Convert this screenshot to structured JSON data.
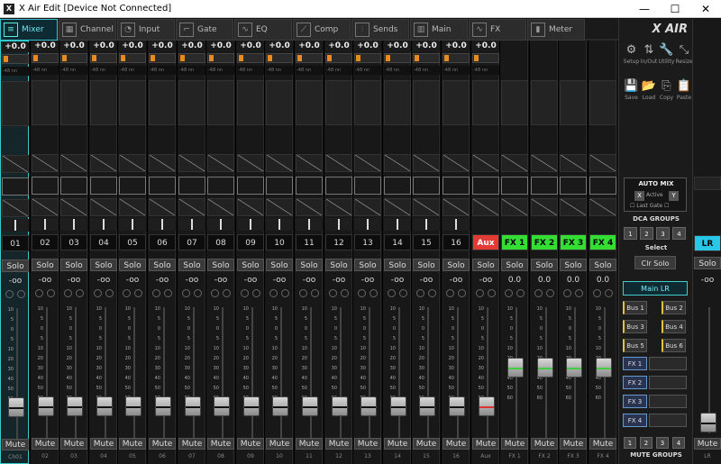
{
  "window": {
    "title": "X Air Edit [Device Not Connected]",
    "icon": "X",
    "min": "—",
    "max": "☐",
    "close": "✕"
  },
  "tabs": [
    {
      "label": "Mixer",
      "icon": "mixer-icon",
      "glyph": "≡"
    },
    {
      "label": "Channel",
      "icon": "channel-icon",
      "glyph": "▦"
    },
    {
      "label": "Input",
      "icon": "input-icon",
      "glyph": "◔"
    },
    {
      "label": "Gate",
      "icon": "gate-icon",
      "glyph": "⌐"
    },
    {
      "label": "EQ",
      "icon": "eq-icon",
      "glyph": "∿"
    },
    {
      "label": "Comp",
      "icon": "comp-icon",
      "glyph": "⟋"
    },
    {
      "label": "Sends",
      "icon": "sends-icon",
      "glyph": "⫶"
    },
    {
      "label": "Main",
      "icon": "main-icon",
      "glyph": "▥"
    },
    {
      "label": "FX",
      "icon": "fx-icon",
      "glyph": "∿"
    },
    {
      "label": "Meter",
      "icon": "meter-icon",
      "glyph": "▮"
    }
  ],
  "channels": [
    {
      "name": "01",
      "label": "Ch01",
      "gain": "+0.0",
      "level": "-oo",
      "kind": "in"
    },
    {
      "name": "02",
      "label": "02",
      "gain": "+0.0",
      "level": "-oo",
      "kind": "in"
    },
    {
      "name": "03",
      "label": "03",
      "gain": "+0.0",
      "level": "-oo",
      "kind": "in"
    },
    {
      "name": "04",
      "label": "04",
      "gain": "+0.0",
      "level": "-oo",
      "kind": "in"
    },
    {
      "name": "05",
      "label": "05",
      "gain": "+0.0",
      "level": "-oo",
      "kind": "in"
    },
    {
      "name": "06",
      "label": "06",
      "gain": "+0.0",
      "level": "-oo",
      "kind": "in"
    },
    {
      "name": "07",
      "label": "07",
      "gain": "+0.0",
      "level": "-oo",
      "kind": "in"
    },
    {
      "name": "08",
      "label": "08",
      "gain": "+0.0",
      "level": "-oo",
      "kind": "in"
    },
    {
      "name": "09",
      "label": "09",
      "gain": "+0.0",
      "level": "-oo",
      "kind": "in"
    },
    {
      "name": "10",
      "label": "10",
      "gain": "+0.0",
      "level": "-oo",
      "kind": "in"
    },
    {
      "name": "11",
      "label": "11",
      "gain": "+0.0",
      "level": "-oo",
      "kind": "in"
    },
    {
      "name": "12",
      "label": "12",
      "gain": "+0.0",
      "level": "-oo",
      "kind": "in"
    },
    {
      "name": "13",
      "label": "13",
      "gain": "+0.0",
      "level": "-oo",
      "kind": "in"
    },
    {
      "name": "14",
      "label": "14",
      "gain": "+0.0",
      "level": "-oo",
      "kind": "in"
    },
    {
      "name": "15",
      "label": "15",
      "gain": "+0.0",
      "level": "-oo",
      "kind": "in"
    },
    {
      "name": "16",
      "label": "16",
      "gain": "+0.0",
      "level": "-oo",
      "kind": "in"
    },
    {
      "name": "Aux",
      "label": "Aux",
      "gain": "+0.0",
      "level": "-oo",
      "kind": "aux",
      "color": "#e53935"
    },
    {
      "name": "FX 1",
      "label": "FX 1",
      "gain": "",
      "level": "0.0",
      "kind": "fx",
      "color": "#33dd33"
    },
    {
      "name": "FX 2",
      "label": "FX 2",
      "gain": "",
      "level": "0.0",
      "kind": "fx",
      "color": "#33dd33"
    },
    {
      "name": "FX 3",
      "label": "FX 3",
      "gain": "",
      "level": "0.0",
      "kind": "fx",
      "color": "#33dd33"
    },
    {
      "name": "FX 4",
      "label": "FX 4",
      "gain": "",
      "level": "0.0",
      "kind": "fx",
      "color": "#33dd33"
    }
  ],
  "common": {
    "solo": "Solo",
    "mute": "Mute",
    "gain_meter": "-48 nn",
    "scale": [
      "10",
      "5",
      "0",
      "5",
      "10",
      "20",
      "30",
      "40",
      "50",
      "60"
    ]
  },
  "tools": [
    {
      "label": "Setup",
      "icon": "setup-icon",
      "glyph": "⚙"
    },
    {
      "label": "In/Out",
      "icon": "in-out-icon",
      "glyph": "⇅"
    },
    {
      "label": "Utility",
      "icon": "utility-icon",
      "glyph": "🔧"
    },
    {
      "label": "Resize",
      "icon": "resize-icon",
      "glyph": "⤡"
    },
    {
      "label": "Save",
      "icon": "save-icon",
      "glyph": "💾"
    },
    {
      "label": "Load",
      "icon": "load-icon",
      "glyph": "📂"
    },
    {
      "label": "Copy",
      "icon": "copy-icon",
      "glyph": "⎘"
    },
    {
      "label": "Paste",
      "icon": "paste-icon",
      "glyph": "📋"
    }
  ],
  "side": {
    "logo": "X AIR",
    "automix": {
      "title": "AUTO MIX",
      "x": "X",
      "active": "Active",
      "y": "Y",
      "last_gate": "Last Gate"
    },
    "dca_title": "DCA GROUPS",
    "dca": [
      "1",
      "2",
      "3",
      "4"
    ],
    "select": "Select",
    "clr_solo": "Clr Solo",
    "main_lr": "Main LR",
    "buses": [
      "Bus 1",
      "Bus 2",
      "Bus 3",
      "Bus 4",
      "Bus 5",
      "Bus 6"
    ],
    "fx": [
      "FX 1",
      "FX 2",
      "FX 3",
      "FX 4"
    ],
    "mute_groups": [
      "1",
      "2",
      "3",
      "4"
    ],
    "mute_groups_title": "MUTE GROUPS"
  },
  "lr": {
    "name": "LR",
    "label": "LR",
    "solo": "Solo",
    "level": "-oo",
    "mute": "Mute",
    "color": "#29c6e8"
  },
  "accent": "#39c0cc"
}
